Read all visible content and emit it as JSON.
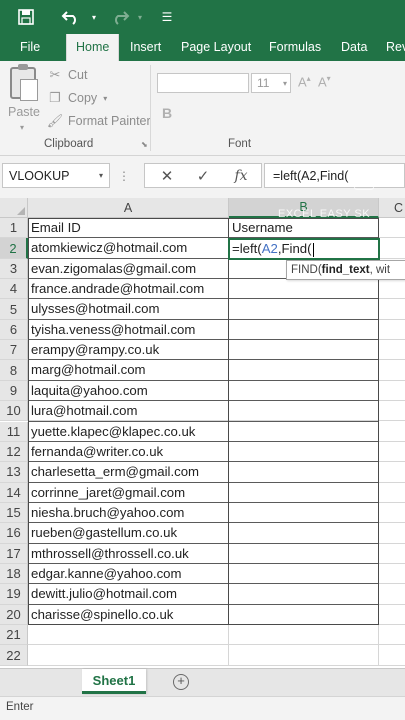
{
  "quick_access": {
    "save_icon": "save-icon",
    "undo_icon": "undo-icon",
    "redo_icon": "redo-icon",
    "dropdown_glyph": "▾",
    "customize_glyph": "☰"
  },
  "ribbon_tabs": [
    "File",
    "Home",
    "Insert",
    "Page Layout",
    "Formulas",
    "Data",
    "Rev"
  ],
  "active_tab": "Home",
  "clipboard": {
    "paste_label": "Paste",
    "cut_label": "Cut",
    "copy_label": "Copy",
    "format_painter_label": "Format Painter",
    "group_label": "Clipboard"
  },
  "font_group": {
    "font_name": "",
    "font_size": "11",
    "group_label": "Font"
  },
  "formula_bar": {
    "name_box": "VLOOKUP",
    "formula": "=left(A2,Find("
  },
  "columns": [
    "A",
    "B",
    "C"
  ],
  "selected_column": "B",
  "selected_row": "2",
  "rows": [
    {
      "num": "1",
      "a": "Email ID",
      "b": "Username"
    },
    {
      "num": "2",
      "a": "atomkiewicz@hotmail.com",
      "b": ""
    },
    {
      "num": "3",
      "a": "evan.zigomalas@gmail.com",
      "b": ""
    },
    {
      "num": "4",
      "a": "france.andrade@hotmail.com",
      "b": ""
    },
    {
      "num": "5",
      "a": "ulysses@hotmail.com",
      "b": ""
    },
    {
      "num": "6",
      "a": "tyisha.veness@hotmail.com",
      "b": ""
    },
    {
      "num": "7",
      "a": "erampy@rampy.co.uk",
      "b": ""
    },
    {
      "num": "8",
      "a": "marg@hotmail.com",
      "b": ""
    },
    {
      "num": "9",
      "a": "laquita@yahoo.com",
      "b": ""
    },
    {
      "num": "10",
      "a": "lura@hotmail.com",
      "b": ""
    },
    {
      "num": "11",
      "a": "yuette.klapec@klapec.co.uk",
      "b": ""
    },
    {
      "num": "12",
      "a": "fernanda@writer.co.uk",
      "b": ""
    },
    {
      "num": "13",
      "a": "charlesetta_erm@gmail.com",
      "b": ""
    },
    {
      "num": "14",
      "a": "corrinne_jaret@gmail.com",
      "b": ""
    },
    {
      "num": "15",
      "a": "niesha.bruch@yahoo.com",
      "b": ""
    },
    {
      "num": "16",
      "a": "rueben@gastellum.co.uk",
      "b": ""
    },
    {
      "num": "17",
      "a": "mthrossell@throssell.co.uk",
      "b": ""
    },
    {
      "num": "18",
      "a": "edgar.kanne@yahoo.com",
      "b": ""
    },
    {
      "num": "19",
      "a": "dewitt.julio@hotmail.com",
      "b": ""
    },
    {
      "num": "20",
      "a": "charisse@spinello.co.uk",
      "b": ""
    },
    {
      "num": "21",
      "a": "",
      "b": ""
    },
    {
      "num": "22",
      "a": "",
      "b": ""
    }
  ],
  "active_cell": {
    "prefix": "=left(",
    "ref": "A2",
    "suffix": ",Find("
  },
  "tooltip": {
    "func": "FIND(",
    "arg": "find_text",
    "rest": ", wit"
  },
  "watermark": "EXCEL EASY SK",
  "sheet_tabs": [
    "Sheet1"
  ],
  "add_sheet_glyph": "+",
  "status": "Enter"
}
